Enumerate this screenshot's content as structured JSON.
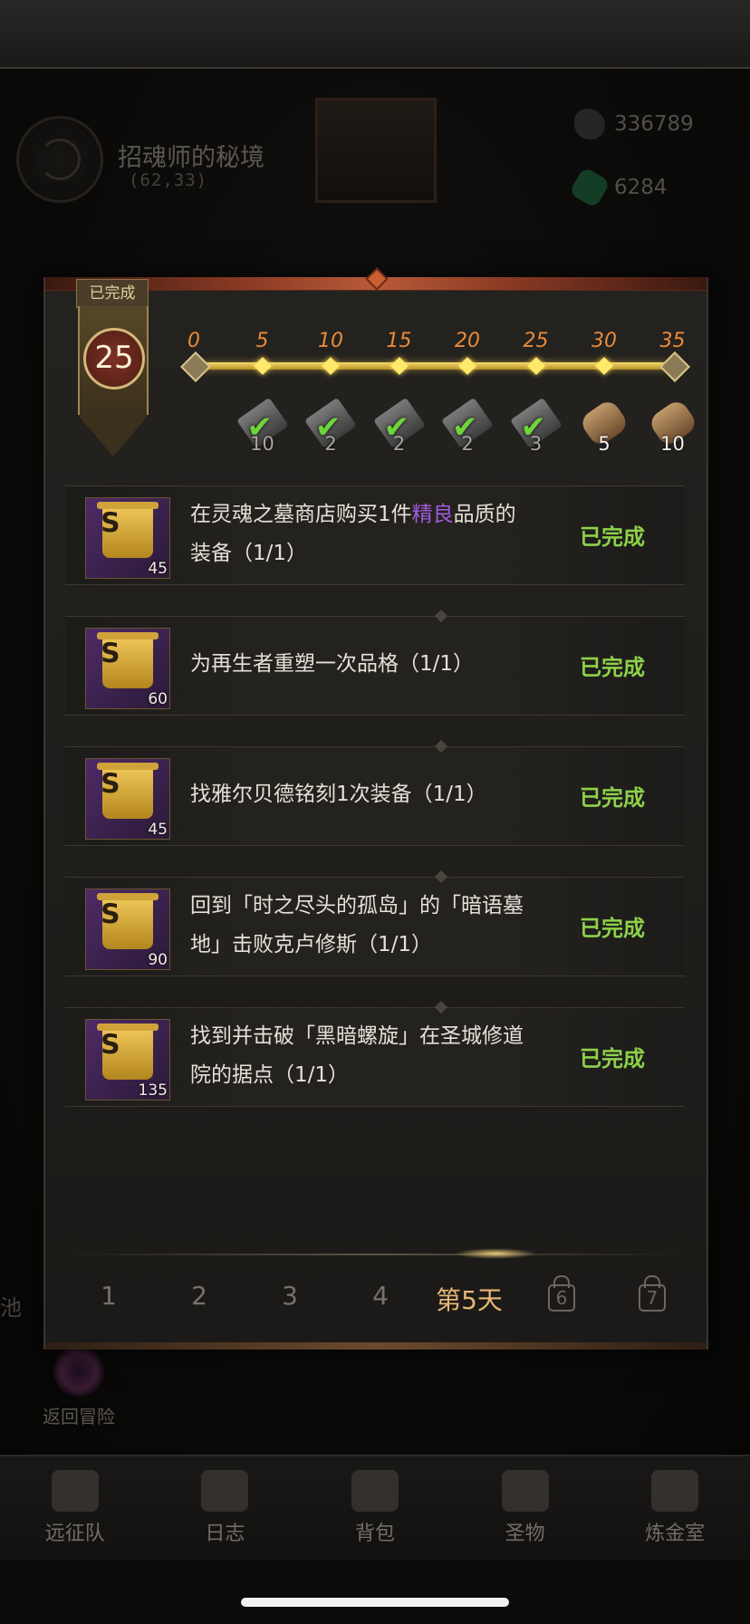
{
  "location": {
    "name": "招魂师的秘境",
    "coords": "(62,33)"
  },
  "resources": [
    {
      "icon": "stone-icon",
      "value": "336789"
    },
    {
      "icon": "green-crystal-icon",
      "value": "6284"
    }
  ],
  "progress": {
    "status_label": "已完成",
    "score": "25",
    "milestones": [
      {
        "label": "0"
      },
      {
        "label": "5",
        "reward_count": "10",
        "reward_icon": "gray-scroll-icon",
        "claimed": true
      },
      {
        "label": "10",
        "reward_count": "2",
        "reward_icon": "gray-scroll-icon",
        "claimed": true
      },
      {
        "label": "15",
        "reward_count": "2",
        "reward_icon": "gray-scroll-icon",
        "claimed": true
      },
      {
        "label": "20",
        "reward_count": "2",
        "reward_icon": "gray-scroll-icon",
        "claimed": true
      },
      {
        "label": "25",
        "reward_count": "3",
        "reward_icon": "gray-scroll-icon",
        "claimed": true
      },
      {
        "label": "30",
        "reward_count": "5",
        "reward_icon": "scroll-icon",
        "claimed": false
      },
      {
        "label": "35",
        "reward_count": "10",
        "reward_icon": "scroll-icon",
        "claimed": false
      }
    ]
  },
  "tasks": [
    {
      "points": "45",
      "desc_before": "在灵魂之墓商店购买1件",
      "desc_highlight": "精良",
      "desc_after": "品质的装备（1/1）",
      "status": "已完成"
    },
    {
      "points": "60",
      "desc": "为再生者重塑一次品格（1/1）",
      "status": "已完成"
    },
    {
      "points": "45",
      "desc": "找雅尔贝德铭刻1次装备（1/1）",
      "status": "已完成"
    },
    {
      "points": "90",
      "desc": "回到「时之尽头的孤岛」的「暗语墓地」击败克卢修斯（1/1）",
      "status": "已完成"
    },
    {
      "points": "135",
      "desc": "找到并击破「黑暗螺旋」在圣城修道院的据点（1/1）",
      "status": "已完成"
    }
  ],
  "day_tabs": [
    {
      "label": "1"
    },
    {
      "label": "2"
    },
    {
      "label": "3"
    },
    {
      "label": "4"
    },
    {
      "label": "第5天",
      "active": true
    },
    {
      "label": "6",
      "locked": true
    },
    {
      "label": "7",
      "locked": true
    }
  ],
  "return_label": "返回冒险",
  "left_partial_text": "池",
  "bottom_nav": [
    {
      "label": "远征队",
      "icon": "helmet-icon"
    },
    {
      "label": "日志",
      "icon": "journal-icon"
    },
    {
      "label": "背包",
      "icon": "backpack-icon"
    },
    {
      "label": "圣物",
      "icon": "relic-icon"
    },
    {
      "label": "炼金室",
      "icon": "alchemy-icon"
    }
  ],
  "colors": {
    "accent_gold": "#e8b776",
    "complete_green": "#8ed04a",
    "quality_purple": "#a25adc",
    "milestone_orange": "#e88a3a"
  }
}
